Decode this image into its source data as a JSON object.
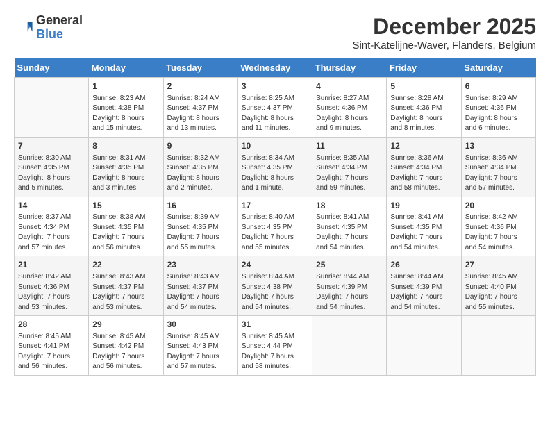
{
  "logo": {
    "general": "General",
    "blue": "Blue"
  },
  "title": "December 2025",
  "subtitle": "Sint-Katelijne-Waver, Flanders, Belgium",
  "days_of_week": [
    "Sunday",
    "Monday",
    "Tuesday",
    "Wednesday",
    "Thursday",
    "Friday",
    "Saturday"
  ],
  "weeks": [
    [
      {
        "day": "",
        "info": ""
      },
      {
        "day": "1",
        "info": "Sunrise: 8:23 AM\nSunset: 4:38 PM\nDaylight: 8 hours\nand 15 minutes."
      },
      {
        "day": "2",
        "info": "Sunrise: 8:24 AM\nSunset: 4:37 PM\nDaylight: 8 hours\nand 13 minutes."
      },
      {
        "day": "3",
        "info": "Sunrise: 8:25 AM\nSunset: 4:37 PM\nDaylight: 8 hours\nand 11 minutes."
      },
      {
        "day": "4",
        "info": "Sunrise: 8:27 AM\nSunset: 4:36 PM\nDaylight: 8 hours\nand 9 minutes."
      },
      {
        "day": "5",
        "info": "Sunrise: 8:28 AM\nSunset: 4:36 PM\nDaylight: 8 hours\nand 8 minutes."
      },
      {
        "day": "6",
        "info": "Sunrise: 8:29 AM\nSunset: 4:36 PM\nDaylight: 8 hours\nand 6 minutes."
      }
    ],
    [
      {
        "day": "7",
        "info": "Sunrise: 8:30 AM\nSunset: 4:35 PM\nDaylight: 8 hours\nand 5 minutes."
      },
      {
        "day": "8",
        "info": "Sunrise: 8:31 AM\nSunset: 4:35 PM\nDaylight: 8 hours\nand 3 minutes."
      },
      {
        "day": "9",
        "info": "Sunrise: 8:32 AM\nSunset: 4:35 PM\nDaylight: 8 hours\nand 2 minutes."
      },
      {
        "day": "10",
        "info": "Sunrise: 8:34 AM\nSunset: 4:35 PM\nDaylight: 8 hours\nand 1 minute."
      },
      {
        "day": "11",
        "info": "Sunrise: 8:35 AM\nSunset: 4:34 PM\nDaylight: 7 hours\nand 59 minutes."
      },
      {
        "day": "12",
        "info": "Sunrise: 8:36 AM\nSunset: 4:34 PM\nDaylight: 7 hours\nand 58 minutes."
      },
      {
        "day": "13",
        "info": "Sunrise: 8:36 AM\nSunset: 4:34 PM\nDaylight: 7 hours\nand 57 minutes."
      }
    ],
    [
      {
        "day": "14",
        "info": "Sunrise: 8:37 AM\nSunset: 4:34 PM\nDaylight: 7 hours\nand 57 minutes."
      },
      {
        "day": "15",
        "info": "Sunrise: 8:38 AM\nSunset: 4:35 PM\nDaylight: 7 hours\nand 56 minutes."
      },
      {
        "day": "16",
        "info": "Sunrise: 8:39 AM\nSunset: 4:35 PM\nDaylight: 7 hours\nand 55 minutes."
      },
      {
        "day": "17",
        "info": "Sunrise: 8:40 AM\nSunset: 4:35 PM\nDaylight: 7 hours\nand 55 minutes."
      },
      {
        "day": "18",
        "info": "Sunrise: 8:41 AM\nSunset: 4:35 PM\nDaylight: 7 hours\nand 54 minutes."
      },
      {
        "day": "19",
        "info": "Sunrise: 8:41 AM\nSunset: 4:35 PM\nDaylight: 7 hours\nand 54 minutes."
      },
      {
        "day": "20",
        "info": "Sunrise: 8:42 AM\nSunset: 4:36 PM\nDaylight: 7 hours\nand 54 minutes."
      }
    ],
    [
      {
        "day": "21",
        "info": "Sunrise: 8:42 AM\nSunset: 4:36 PM\nDaylight: 7 hours\nand 53 minutes."
      },
      {
        "day": "22",
        "info": "Sunrise: 8:43 AM\nSunset: 4:37 PM\nDaylight: 7 hours\nand 53 minutes."
      },
      {
        "day": "23",
        "info": "Sunrise: 8:43 AM\nSunset: 4:37 PM\nDaylight: 7 hours\nand 54 minutes."
      },
      {
        "day": "24",
        "info": "Sunrise: 8:44 AM\nSunset: 4:38 PM\nDaylight: 7 hours\nand 54 minutes."
      },
      {
        "day": "25",
        "info": "Sunrise: 8:44 AM\nSunset: 4:39 PM\nDaylight: 7 hours\nand 54 minutes."
      },
      {
        "day": "26",
        "info": "Sunrise: 8:44 AM\nSunset: 4:39 PM\nDaylight: 7 hours\nand 54 minutes."
      },
      {
        "day": "27",
        "info": "Sunrise: 8:45 AM\nSunset: 4:40 PM\nDaylight: 7 hours\nand 55 minutes."
      }
    ],
    [
      {
        "day": "28",
        "info": "Sunrise: 8:45 AM\nSunset: 4:41 PM\nDaylight: 7 hours\nand 56 minutes."
      },
      {
        "day": "29",
        "info": "Sunrise: 8:45 AM\nSunset: 4:42 PM\nDaylight: 7 hours\nand 56 minutes."
      },
      {
        "day": "30",
        "info": "Sunrise: 8:45 AM\nSunset: 4:43 PM\nDaylight: 7 hours\nand 57 minutes."
      },
      {
        "day": "31",
        "info": "Sunrise: 8:45 AM\nSunset: 4:44 PM\nDaylight: 7 hours\nand 58 minutes."
      },
      {
        "day": "",
        "info": ""
      },
      {
        "day": "",
        "info": ""
      },
      {
        "day": "",
        "info": ""
      }
    ]
  ]
}
